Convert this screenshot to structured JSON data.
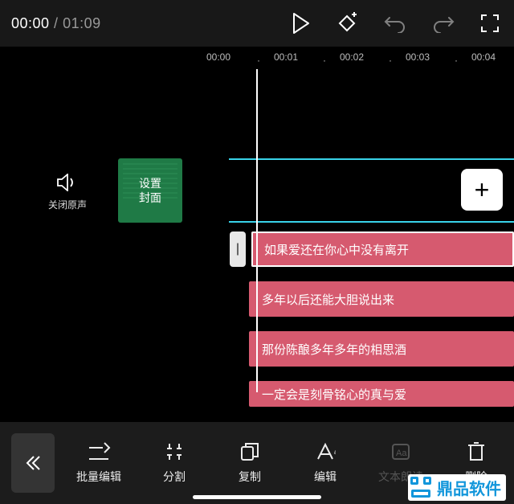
{
  "time": {
    "current": "00:00",
    "sep": " / ",
    "duration": "01:09"
  },
  "ticks": [
    "00:00",
    "00:01",
    "00:02",
    "00:03",
    "00:04"
  ],
  "stage": {
    "mute_label": "关闭原声",
    "cover_label": "设置\n封面",
    "add_label": "+",
    "handle_glyph": "|"
  },
  "lyrics": [
    "如果爱还在你心中没有离开",
    "多年以后还能大胆说出来",
    "那份陈酿多年多年的相思酒",
    "一定会是刻骨铭心的真与爱"
  ],
  "toolbar": {
    "batch": "批量编辑",
    "split": "分割",
    "copy": "复制",
    "edit": "编辑",
    "tts": "文本朗读",
    "delete": "删除"
  },
  "watermark": "鼎品软件"
}
